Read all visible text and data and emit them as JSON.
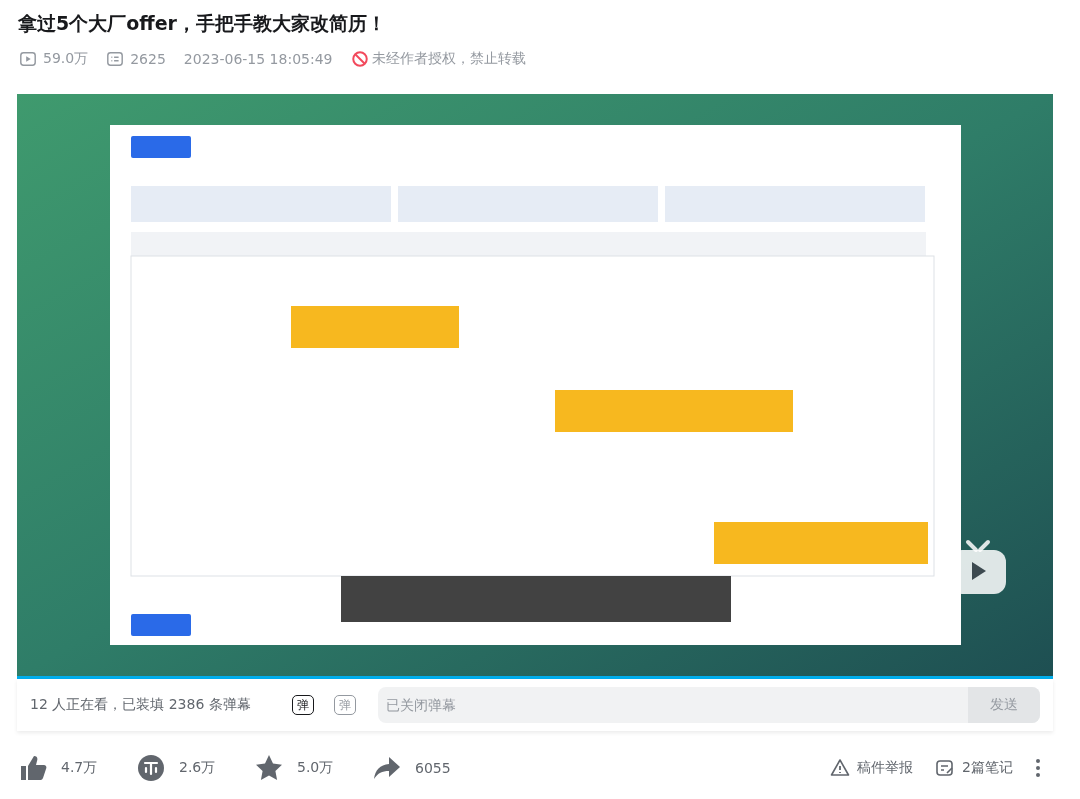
{
  "title": "拿过5个大厂offer，手把手教大家改简历！",
  "meta": {
    "views": "59.0万",
    "danmaku_count": "2625",
    "date": "2023-06-15 18:05:49",
    "copyright": "未经作者授权，禁止转载"
  },
  "video": {
    "kind": "picture",
    "progress": {
      "level": 1
    }
  },
  "danmaku_bar": {
    "status": "12 人正在看，已装填 2386 条弹幕",
    "toggle_glyphs": [
      "弹",
      "弹"
    ],
    "placeholder": "已关闭弹幕",
    "send": "发送"
  },
  "actions": [
    {
      "kind": "like",
      "count": "4.7万"
    },
    {
      "kind": "coin",
      "count": "2.6万"
    },
    {
      "kind": "favorite",
      "count": "5.0万"
    },
    {
      "kind": "share",
      "count": "6055"
    }
  ],
  "right_actions": [
    {
      "kind": "report",
      "label": "稿件举报"
    },
    {
      "kind": "notes",
      "label": "2篇笔记"
    }
  ]
}
